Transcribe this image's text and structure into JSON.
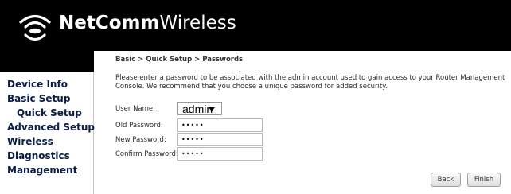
{
  "header": {
    "brand_bold": "NetComm",
    "brand_light": "Wireless",
    "logo_icon": "wifi-logo-icon"
  },
  "sidebar": {
    "items": [
      {
        "label": "Device Info"
      },
      {
        "label": "Basic Setup"
      },
      {
        "label": "Quick Setup"
      },
      {
        "label": "Advanced Setup"
      },
      {
        "label": "Wireless"
      },
      {
        "label": "Diagnostics"
      },
      {
        "label": "Management"
      }
    ]
  },
  "main": {
    "breadcrumb": "Basic > Quick Setup > Passwords",
    "instructions_line1": "Please enter a password to be associated with the admin account used to gain access to your Router Management",
    "instructions_line2": "Console. We recommend that you choose a unique password for added security.",
    "form": {
      "user_name_label": "User Name:",
      "user_name_value": "admin",
      "old_password_label": "Old Password:",
      "old_password_value": "•••••",
      "new_password_label": "New Password:",
      "new_password_value": "•••••",
      "confirm_password_label": "Confirm Password:",
      "confirm_password_value": "•••••"
    },
    "buttons": {
      "back": "Back",
      "finish": "Finish"
    }
  },
  "colors": {
    "header_bg": "#000000",
    "nav_text": "#0a1d45",
    "body_text": "#2a2a2a"
  }
}
